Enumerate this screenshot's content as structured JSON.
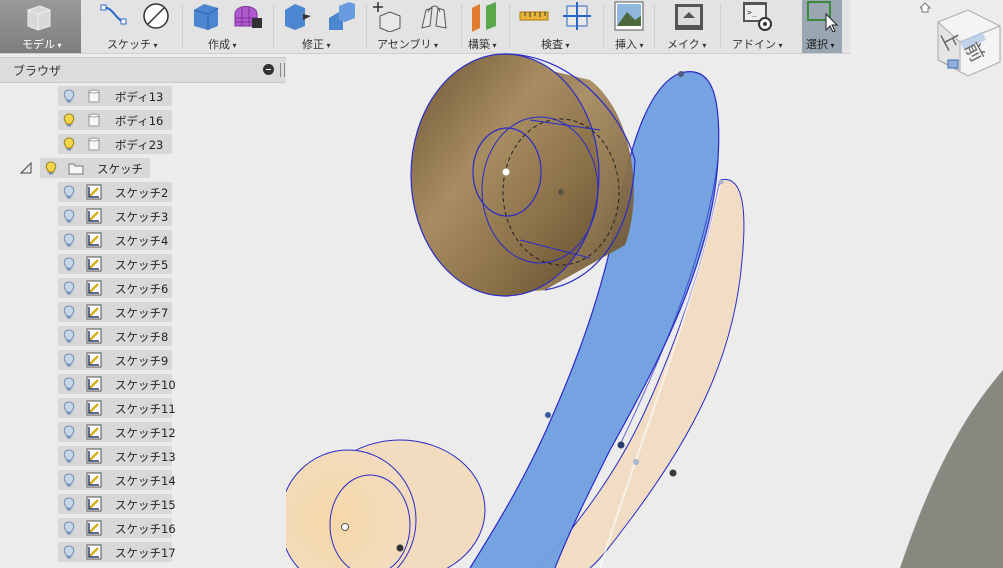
{
  "toolbar": {
    "groups": [
      {
        "id": "model",
        "label": "モデル"
      },
      {
        "id": "sketch",
        "label": "スケッチ"
      },
      {
        "id": "create",
        "label": "作成"
      },
      {
        "id": "modify",
        "label": "修正"
      },
      {
        "id": "assemble",
        "label": "アセンブリ"
      },
      {
        "id": "construct",
        "label": "構築"
      },
      {
        "id": "inspect",
        "label": "検査"
      },
      {
        "id": "insert",
        "label": "挿入"
      },
      {
        "id": "make",
        "label": "メイク"
      },
      {
        "id": "addins",
        "label": "アドイン"
      },
      {
        "id": "select",
        "label": "選択"
      }
    ]
  },
  "browser": {
    "title": "ブラウザ",
    "bodies": [
      {
        "label": "ボディ13",
        "bulb": "off"
      },
      {
        "label": "ボディ16",
        "bulb": "on"
      },
      {
        "label": "ボディ23",
        "bulb": "on"
      }
    ],
    "sketch_folder": {
      "label": "スケッチ",
      "bulb": "on"
    },
    "sketches": [
      {
        "label": "スケッチ2"
      },
      {
        "label": "スケッチ3"
      },
      {
        "label": "スケッチ4"
      },
      {
        "label": "スケッチ5"
      },
      {
        "label": "スケッチ6"
      },
      {
        "label": "スケッチ7"
      },
      {
        "label": "スケッチ8"
      },
      {
        "label": "スケッチ9"
      },
      {
        "label": "スケッチ10"
      },
      {
        "label": "スケッチ11"
      },
      {
        "label": "スケッチ12"
      },
      {
        "label": "スケッチ13"
      },
      {
        "label": "スケッチ14"
      },
      {
        "label": "スケッチ15"
      },
      {
        "label": "スケッチ16"
      },
      {
        "label": "スケッチ17"
      }
    ]
  },
  "viewcube": {
    "face_top": "上",
    "face_front": "前"
  },
  "colors": {
    "blue_body": "#6f9fe0",
    "tan_body": "#f2dcc0",
    "brown_body": "#8a7048",
    "selection": "#2a2ac8"
  }
}
